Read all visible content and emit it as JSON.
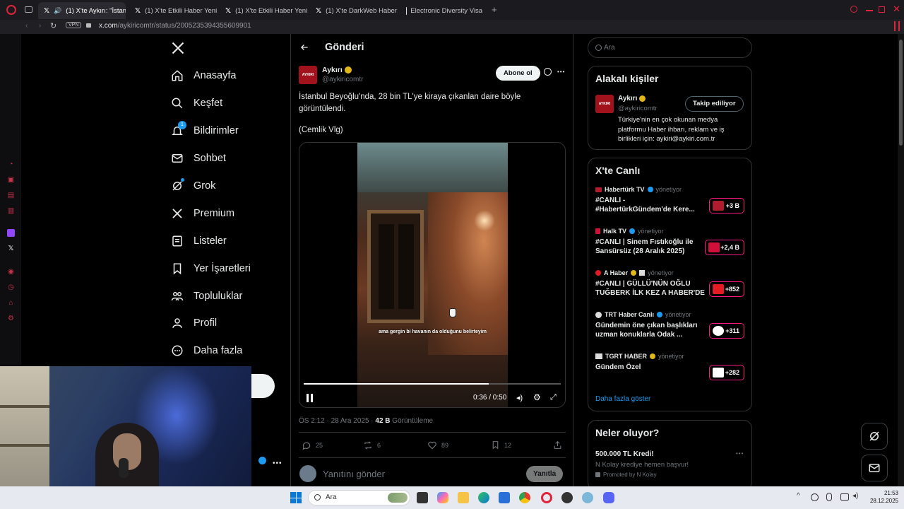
{
  "browser": {
    "tabs": [
      {
        "title": "(1) X'te Aykırı: \"İstanbu",
        "active": true
      },
      {
        "title": "(1) X'te Etkili Haber Yeni S"
      },
      {
        "title": "(1) X'te Etkili Haber Yeni S"
      },
      {
        "title": "(1) X'te DarkWeb Haber: \""
      },
      {
        "title": "Electronic Diversity Visa"
      }
    ],
    "vpn_label": "VPN",
    "url_host": "x.com",
    "url_path": "/aykiricomtr/status/2005235394355609901"
  },
  "nav": {
    "logo": "X",
    "items": [
      {
        "label": "Anasayfa",
        "icon": "home-icon"
      },
      {
        "label": "Keşfet",
        "icon": "search-icon"
      },
      {
        "label": "Bildirimler",
        "icon": "bell-icon",
        "badge": "1"
      },
      {
        "label": "Sohbet",
        "icon": "mail-icon"
      },
      {
        "label": "Grok",
        "icon": "grok-icon"
      },
      {
        "label": "Premium",
        "icon": "x-icon"
      },
      {
        "label": "Listeler",
        "icon": "list-icon"
      },
      {
        "label": "Yer İşaretleri",
        "icon": "bookmark-icon"
      },
      {
        "label": "Topluluklar",
        "icon": "people-icon"
      },
      {
        "label": "Profil",
        "icon": "user-icon"
      },
      {
        "label": "Daha fazla",
        "icon": "more-circle-icon"
      }
    ]
  },
  "post": {
    "header_title": "Gönderi",
    "author_name": "Aykırı",
    "author_handle": "@aykiricomtr",
    "avatar_text": "AYKIRI",
    "subscribe_label": "Abone ol",
    "text_line1": "İstanbul Beyoğlu'nda, 28 bin TL'ye kiraya çıkanlan daire böyle",
    "text_line2": "görüntülendi.",
    "credit": "(Cemlik Vlg)",
    "video_subtitle": "ama gergin bi havanın da olduğunu belirteyim",
    "video_time": "0:36 / 0:50",
    "video_progress": 0.72,
    "meta_time": "ÖS 2:12 · 28 Ara 2025 · ",
    "views_count": "42 B",
    "views_label": " Görüntüleme",
    "replies": "25",
    "reposts": "6",
    "likes": "89",
    "bookmarks": "12",
    "reply_placeholder": "Yanıtını gönder",
    "reply_button": "Yanıtla"
  },
  "search": {
    "placeholder": "Ara"
  },
  "related": {
    "title": "Alakalı kişiler",
    "name": "Aykırı",
    "handle": "@aykiricomtr",
    "follow_label": "Takip ediliyor",
    "bio": "Türkiye'nin en çok okunan medya platformu Haber ihbarı, reklam ve iş birlikleri için: aykiri@aykiri.com.tr"
  },
  "live": {
    "title": "X'te Canlı",
    "items": [
      {
        "host": "Habertürk TV",
        "managing": "yönetiyor",
        "title": "#CANLI - #HabertürkGündem'de Kere...",
        "count": "+3 B",
        "logo_color": "#b01c2e"
      },
      {
        "host": "Halk TV",
        "managing": "yönetiyor",
        "title": "#CANLI | Sinem Fıstıkoğlu ile Sansürsüz (28 Aralık 2025)",
        "count": "+2,4 B",
        "logo_color": "#d0103a"
      },
      {
        "host": "A Haber",
        "managing": "yönetiyor",
        "title": "#CANLI | GÜLLÜ'NÜN OĞLU TUĞBERK İLK KEZ A HABER'DE",
        "count": "+852",
        "logo_color": "#e31b23"
      },
      {
        "host": "TRT Haber Canlı",
        "managing": "yönetiyor",
        "title": "Gündemin öne çıkan başlıkları uzman konuklarla Odak ...",
        "count": "+311",
        "logo_color": "#ffffff"
      },
      {
        "host": "TGRT HABER",
        "managing": "yönetiyor",
        "title": "Gündem Özel",
        "count": "+282",
        "logo_color": "#ffffff"
      }
    ],
    "show_more": "Daha fazla göster"
  },
  "whats_happening": {
    "title": "Neler oluyor?",
    "promo_title": "500.000 TL Kredi!",
    "promo_text": "N Kolay krediye hemen başvur!",
    "promo_by": "Promoted by N Kolay"
  },
  "taskbar": {
    "search": "Ara",
    "time": "21:53",
    "date": "28.12.2025"
  },
  "colors": {
    "accent": "#1d9bf0",
    "live": "#f91880",
    "verified_gold": "#e2b719"
  }
}
